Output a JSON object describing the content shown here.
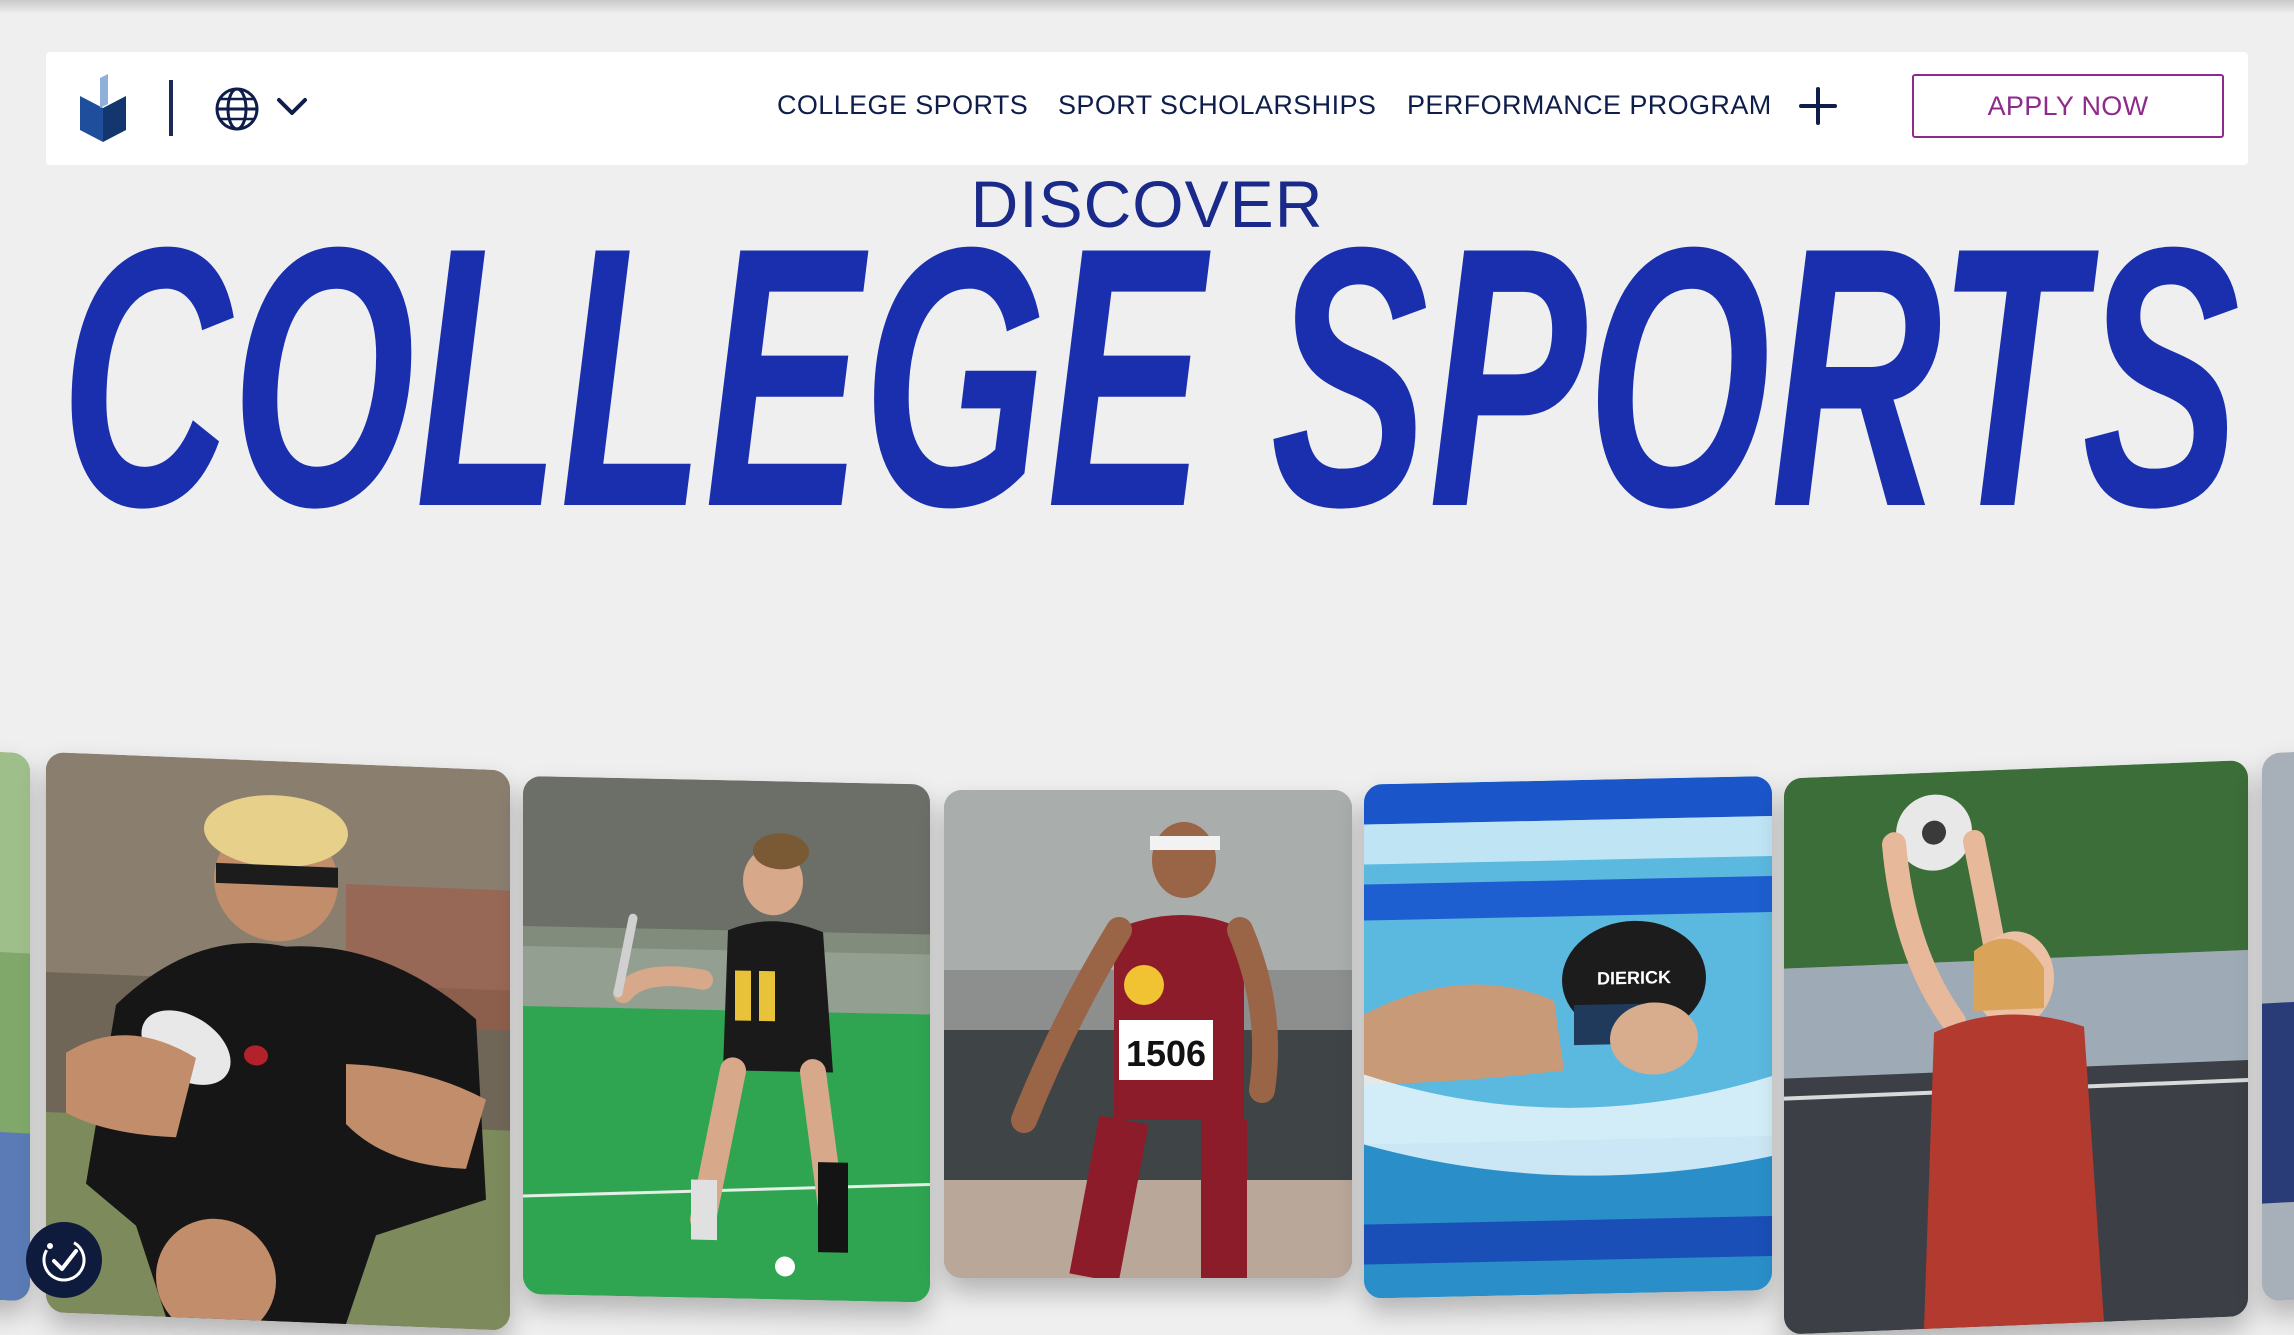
{
  "nav": {
    "links": [
      {
        "label": "COLLEGE SPORTS"
      },
      {
        "label": "SPORT SCHOLARSHIPS"
      },
      {
        "label": "PERFORMANCE PROGRAM"
      }
    ],
    "apply_label": "APPLY NOW"
  },
  "hero": {
    "kicker": "DISCOVER",
    "headline": "COLLEGE SPORTS"
  },
  "cards": [
    {
      "sport": "rugby",
      "bib": "",
      "cap": ""
    },
    {
      "sport": "field-hockey",
      "bib": "",
      "cap": ""
    },
    {
      "sport": "track",
      "bib": "1506",
      "cap": ""
    },
    {
      "sport": "swimming",
      "bib": "",
      "cap": "DIERICK"
    },
    {
      "sport": "soccer",
      "bib": "",
      "cap": ""
    }
  ],
  "colors": {
    "brand_blue": "#1a2fae",
    "navy": "#0f1d4a",
    "apply_accent": "#8e2a8c",
    "background": "#efefef"
  },
  "icons": [
    "logo-icon",
    "globe-icon",
    "chevron-down-icon",
    "plus-icon",
    "accessibility-check-icon"
  ]
}
